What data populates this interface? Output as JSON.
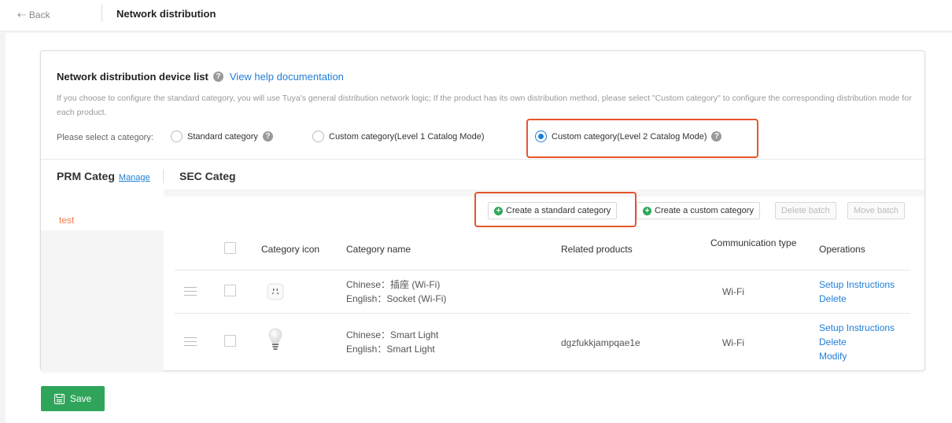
{
  "header": {
    "back_label": "Back",
    "title": "Network distribution"
  },
  "device_list": {
    "title": "Network distribution device list",
    "help_link": "View help documentation",
    "description": "If you choose to configure the standard category, you will use Tuya's general distribution network logic; If the product has its own distribution method, please select \"Custom category\" to configure the corresponding distribution mode for each product.",
    "category_prompt": "Please select a category:",
    "options": [
      {
        "label": "Standard category",
        "selected": false,
        "help": true
      },
      {
        "label": "Custom category(Level 1 Catalog Mode)",
        "selected": false,
        "help": false
      },
      {
        "label": "Custom category(Level 2 Catalog Mode)",
        "selected": true,
        "help": true
      }
    ]
  },
  "panes": {
    "primary_title": "PRM Categ",
    "manage_label": "Manage",
    "secondary_title": "SEC Categ"
  },
  "primary_categories": [
    {
      "label": "test",
      "active": true
    }
  ],
  "toolbar": {
    "create_standard": "Create a standard category",
    "create_custom": "Create a custom category",
    "delete_batch": "Delete batch",
    "move_batch": "Move batch"
  },
  "table": {
    "columns": [
      "Category icon",
      "Category name",
      "Related products",
      "Communication type",
      "Operations"
    ],
    "rows": [
      {
        "icon": "socket-icon",
        "name_cn": "Chinese：插座 (Wi-Fi)",
        "name_en": "English：Socket (Wi-Fi)",
        "related_products": "",
        "communication": "Wi-Fi",
        "operations": [
          "Setup Instructions",
          "Delete"
        ]
      },
      {
        "icon": "light-bulb-icon",
        "name_cn": "Chinese：Smart Light",
        "name_en": "English：Smart Light",
        "related_products": "dgzfukkjampqae1e",
        "communication": "Wi-Fi",
        "operations": [
          "Setup Instructions",
          "Delete",
          "Modify"
        ]
      }
    ]
  },
  "footer": {
    "save_label": "Save"
  },
  "colors": {
    "accent_blue": "#1f7ed6",
    "highlight_red": "#e8542e",
    "save_green": "#2fa55b",
    "active_orange": "#f07c4b"
  }
}
